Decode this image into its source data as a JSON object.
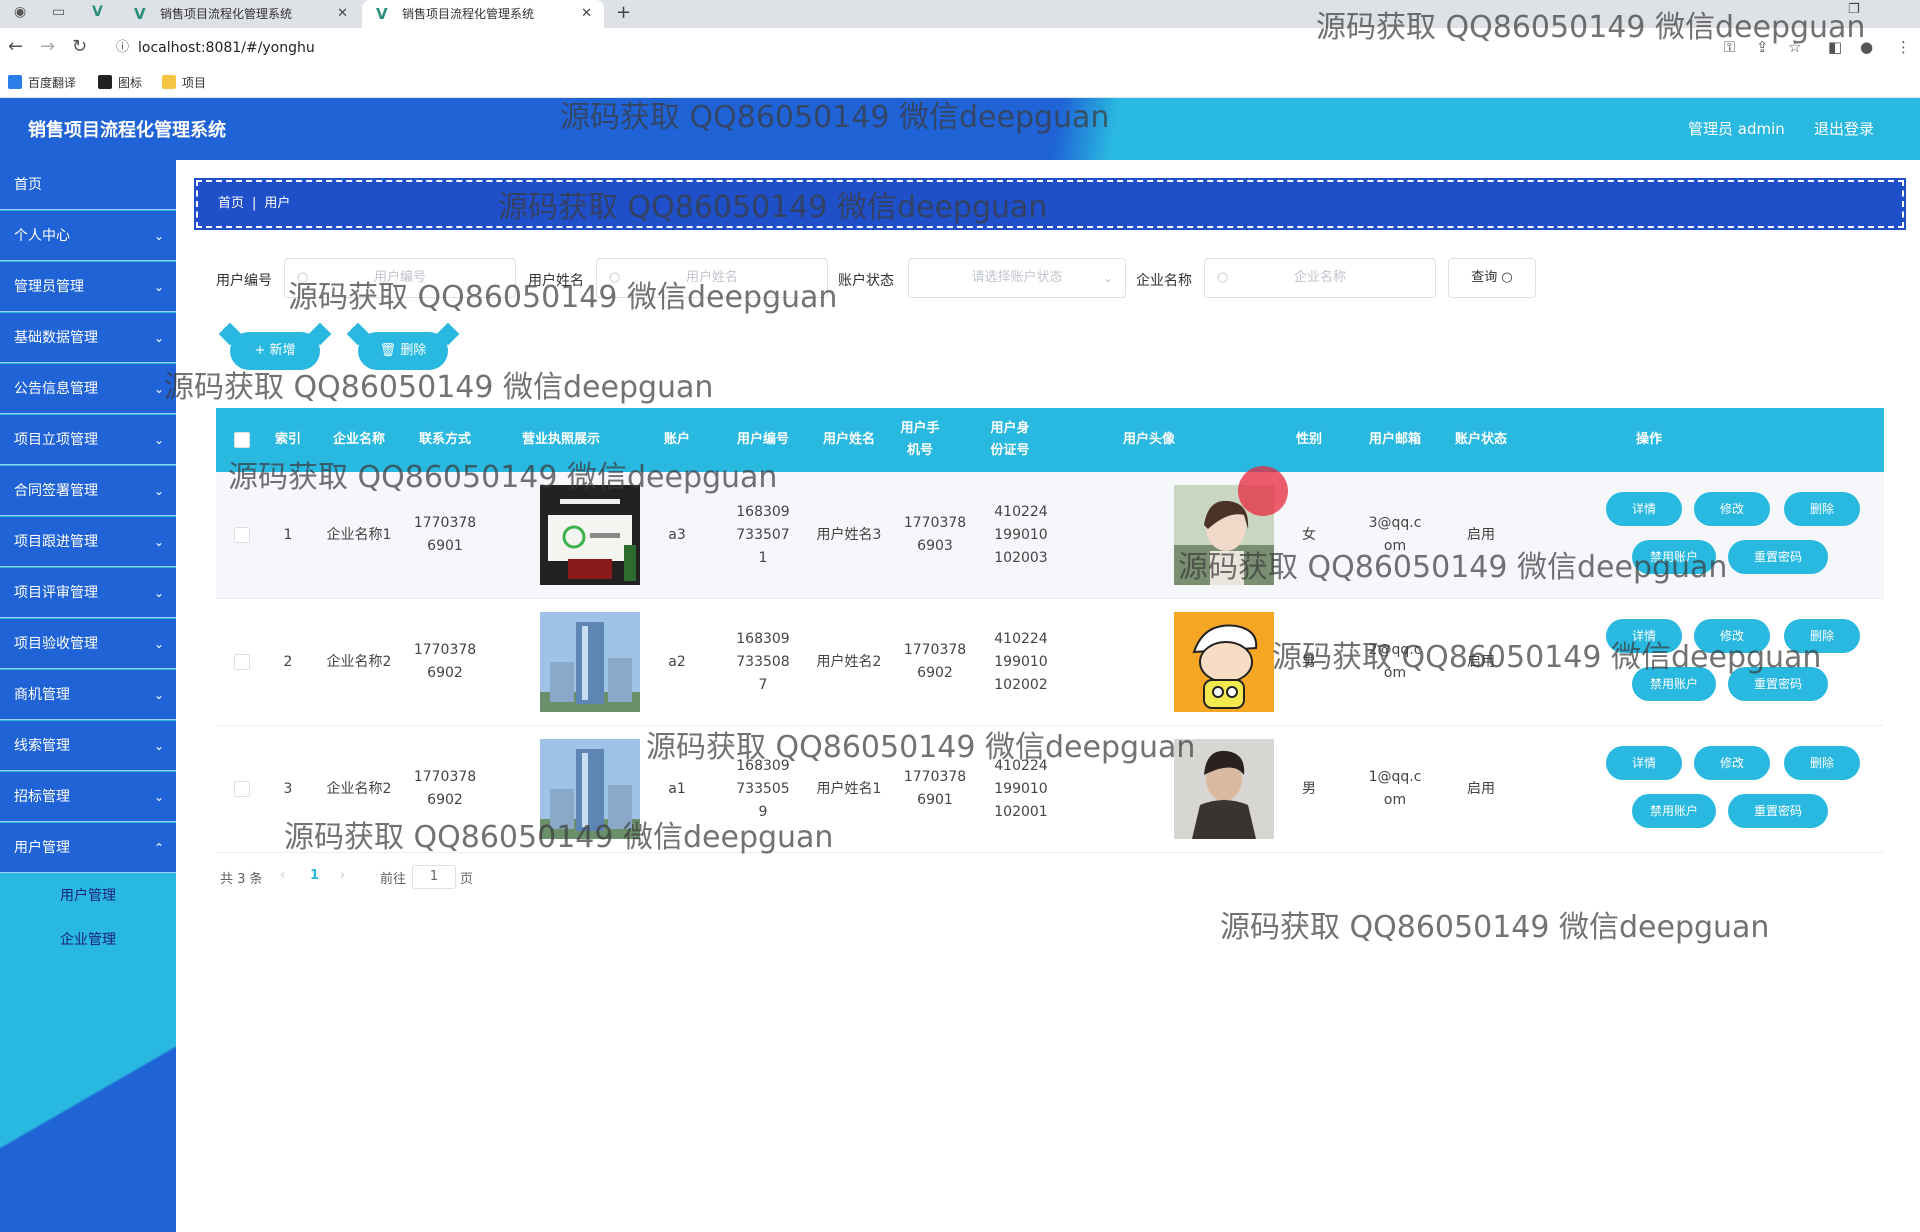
{
  "browser": {
    "tabs": [
      {
        "label": "销售项目流程化管理系统"
      },
      {
        "label": "销售项目流程化管理系统"
      }
    ],
    "url": "localhost:8081/#/yonghu",
    "bookmarks": [
      "百度翻译",
      "图标",
      "项目"
    ]
  },
  "header": {
    "title": "销售项目流程化管理系统",
    "user": "管理员 admin",
    "logout": "退出登录"
  },
  "sidebar": {
    "items": [
      {
        "label": "首页"
      },
      {
        "label": "个人中心"
      },
      {
        "label": "管理员管理"
      },
      {
        "label": "基础数据管理"
      },
      {
        "label": "公告信息管理"
      },
      {
        "label": "项目立项管理"
      },
      {
        "label": "合同签署管理"
      },
      {
        "label": "项目跟进管理"
      },
      {
        "label": "项目评审管理"
      },
      {
        "label": "项目验收管理"
      },
      {
        "label": "商机管理"
      },
      {
        "label": "线索管理"
      },
      {
        "label": "招标管理"
      },
      {
        "label": "用户管理"
      }
    ],
    "sub_items": [
      {
        "label": "用户管理"
      },
      {
        "label": "企业管理"
      }
    ]
  },
  "breadcrumb": {
    "home": "首页",
    "current": "用户"
  },
  "search": {
    "user_no_label": "用户编号",
    "user_no_placeholder": "用户编号",
    "user_name_label": "用户姓名",
    "user_name_placeholder": "用户姓名",
    "status_label": "账户状态",
    "status_placeholder": "请选择账户状态",
    "company_label": "企业名称",
    "company_placeholder": "企业名称",
    "query_button": "查询"
  },
  "toolbar": {
    "add": "+ 新增",
    "delete": "删除"
  },
  "table": {
    "columns": [
      "索引",
      "企业名称",
      "联系方式",
      "营业执照展示",
      "账户",
      "用户编号",
      "用户姓名",
      "用户手机号",
      "用户身份证号",
      "用户头像",
      "性别",
      "用户邮箱",
      "账户状态",
      "操作"
    ],
    "rows": [
      {
        "index": "1",
        "company": "企业名称1",
        "contact": "17703786901",
        "account": "a3",
        "user_no": "1683097335071",
        "name": "用户姓名3",
        "phone": "17703786903",
        "id_card": "410224199010102003",
        "gender": "女",
        "email": "3@qq.com",
        "status": "启用"
      },
      {
        "index": "2",
        "company": "企业名称2",
        "contact": "17703786902",
        "account": "a2",
        "user_no": "1683097335087",
        "name": "用户姓名2",
        "phone": "17703786902",
        "id_card": "410224199010102002",
        "gender": "男",
        "email": "2@qq.com",
        "status": "启用"
      },
      {
        "index": "3",
        "company": "企业名称2",
        "contact": "17703786902",
        "account": "a1",
        "user_no": "1683097335059",
        "name": "用户姓名1",
        "phone": "17703786901",
        "id_card": "410224199010102001",
        "gender": "男",
        "email": "1@qq.com",
        "status": "启用"
      }
    ],
    "ops": {
      "detail": "详情",
      "edit": "修改",
      "delete": "删除",
      "disable": "禁用账户",
      "reset": "重置密码"
    }
  },
  "pagination": {
    "total": "共 3 条",
    "page": "1",
    "goto": "前往",
    "goto_value": "1",
    "unit": "页"
  },
  "watermark": "源码获取 QQ86050149 微信deepguan",
  "colors": {
    "primary_blue": "#1f63d6",
    "cyan": "#29b8e0"
  }
}
